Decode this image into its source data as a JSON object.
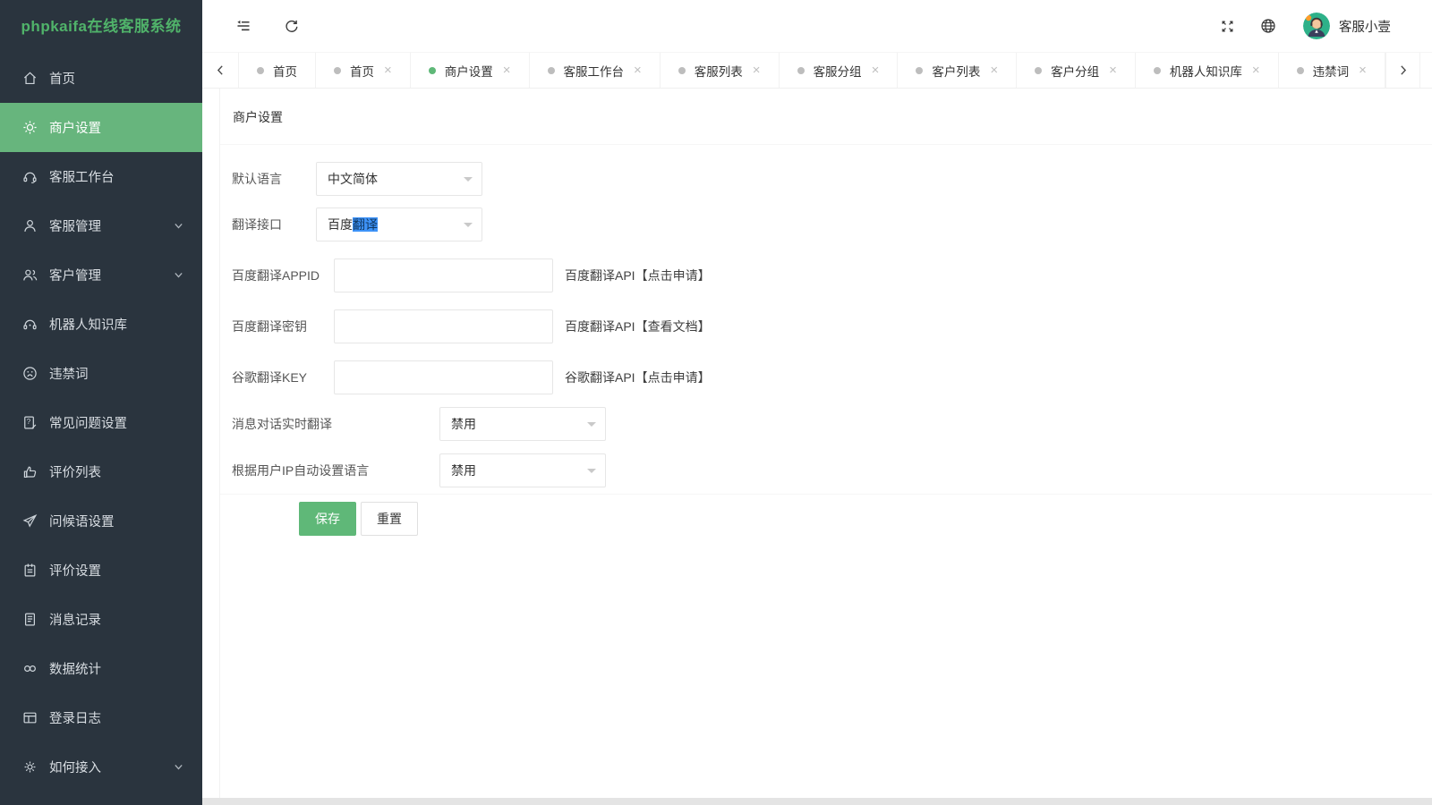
{
  "app": {
    "title": "phpkaifa在线客服系统"
  },
  "colors": {
    "accent_green": "#5fb878",
    "sidebar_bg": "#2a343e",
    "active_item_bg": "#67b57d",
    "selection_blue": "#3e93f8"
  },
  "topbar": {
    "left_icons": [
      "sidebar-collapse-icon",
      "refresh-icon"
    ],
    "right_icons": [
      "fullscreen-icon",
      "globe-icon"
    ],
    "user": {
      "name": "客服小壹",
      "avatar_icon": "agent-avatar"
    }
  },
  "tabbar": {
    "scroll_left_icon": "chevron-left-icon",
    "scroll_right_icon": "chevron-right-icon",
    "menu_icon": "chevron-down-icon",
    "tabs": [
      {
        "label": "首页",
        "closable": false,
        "active": false
      },
      {
        "label": "首页",
        "closable": true,
        "active": false
      },
      {
        "label": "商户设置",
        "closable": true,
        "active": true
      },
      {
        "label": "客服工作台",
        "closable": true,
        "active": false
      },
      {
        "label": "客服列表",
        "closable": true,
        "active": false
      },
      {
        "label": "客服分组",
        "closable": true,
        "active": false
      },
      {
        "label": "客户列表",
        "closable": true,
        "active": false
      },
      {
        "label": "客户分组",
        "closable": true,
        "active": false
      },
      {
        "label": "机器人知识库",
        "closable": true,
        "active": false
      },
      {
        "label": "违禁词",
        "closable": true,
        "active": false
      }
    ]
  },
  "sidebar": {
    "items": [
      {
        "label": "首页",
        "icon": "home-icon",
        "active": false,
        "expandable": false
      },
      {
        "label": "商户设置",
        "icon": "gear-icon",
        "active": true,
        "expandable": false
      },
      {
        "label": "客服工作台",
        "icon": "headset-icon",
        "active": false,
        "expandable": false
      },
      {
        "label": "客服管理",
        "icon": "user-icon",
        "active": false,
        "expandable": true
      },
      {
        "label": "客户管理",
        "icon": "users-icon",
        "active": false,
        "expandable": true
      },
      {
        "label": "机器人知识库",
        "icon": "robot-icon",
        "active": false,
        "expandable": false
      },
      {
        "label": "违禁词",
        "icon": "sad-face-icon",
        "active": false,
        "expandable": false
      },
      {
        "label": "常见问题设置",
        "icon": "faq-icon",
        "active": false,
        "expandable": false
      },
      {
        "label": "评价列表",
        "icon": "thumbs-up-icon",
        "active": false,
        "expandable": false
      },
      {
        "label": "问候语设置",
        "icon": "send-icon",
        "active": false,
        "expandable": false
      },
      {
        "label": "评价设置",
        "icon": "notebook-icon",
        "active": false,
        "expandable": false
      },
      {
        "label": "消息记录",
        "icon": "message-log-icon",
        "active": false,
        "expandable": false
      },
      {
        "label": "数据统计",
        "icon": "stats-icon",
        "active": false,
        "expandable": false
      },
      {
        "label": "登录日志",
        "icon": "login-log-icon",
        "active": false,
        "expandable": false
      },
      {
        "label": "如何接入",
        "icon": "integration-icon",
        "active": false,
        "expandable": true
      }
    ]
  },
  "page": {
    "title": "商户设置",
    "form": {
      "rows": [
        {
          "type": "select",
          "label": "默认语言",
          "value": "中文简体",
          "highlighted": "",
          "helper": ""
        },
        {
          "type": "select",
          "label": "翻译接口",
          "value": "百度翻译",
          "highlighted": "翻译",
          "helper": ""
        },
        {
          "type": "input",
          "label": "百度翻译APPID",
          "value": "",
          "placeholder": "",
          "helper": "百度翻译API【点击申请】"
        },
        {
          "type": "input",
          "label": "百度翻译密钥",
          "value": "",
          "placeholder": "",
          "helper": "百度翻译API【查看文档】"
        },
        {
          "type": "input",
          "label": "谷歌翻译KEY",
          "value": "",
          "placeholder": "",
          "helper": "谷歌翻译API【点击申请】"
        },
        {
          "type": "select",
          "label": "消息对话实时翻译",
          "value": "禁用",
          "highlighted": "",
          "helper": ""
        },
        {
          "type": "select",
          "label": "根据用户IP自动设置语言",
          "value": "禁用",
          "highlighted": "",
          "helper": ""
        }
      ],
      "buttons": {
        "save": "保存",
        "reset": "重置"
      }
    }
  }
}
